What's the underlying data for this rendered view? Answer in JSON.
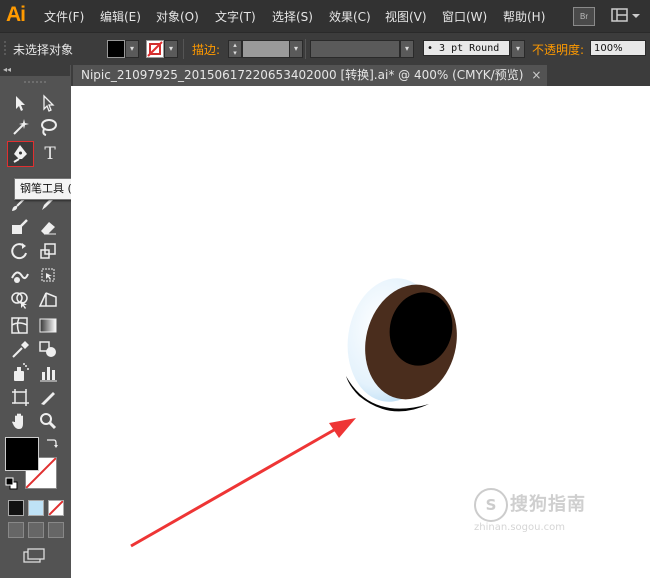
{
  "app": {
    "logo": "Ai"
  },
  "menu": {
    "items": [
      "文件(F)",
      "编辑(E)",
      "对象(O)",
      "文字(T)",
      "选择(S)",
      "效果(C)",
      "视图(V)",
      "窗口(W)",
      "帮助(H)"
    ],
    "bridge_label": "Br"
  },
  "control_bar": {
    "selection_status": "未选择对象",
    "fill_color": "#000000",
    "stroke_label": "描边:",
    "brush_value": "• 3 pt Round",
    "opacity_label": "不透明度:",
    "opacity_value": "100%"
  },
  "toolbox": {
    "collapse_label": "◂◂",
    "tooltip": "钢笔工具 (P)",
    "fill_color": "#000000",
    "stroke_color": "#ffffff"
  },
  "document": {
    "tab_title": "Nipic_21097925_20150617220653402000  [转换].ai* @ 400% (CMYK/预览)",
    "close_label": "×"
  },
  "watermark": {
    "brand": "搜狗指南",
    "url": "zhinan.sogou.com"
  },
  "colors": {
    "accent": "#ff9a00",
    "arrow": "#ee3535",
    "eye_iris": "#4a2d1d",
    "eye_white": "#d6ecfb",
    "pupil": "#000000"
  }
}
